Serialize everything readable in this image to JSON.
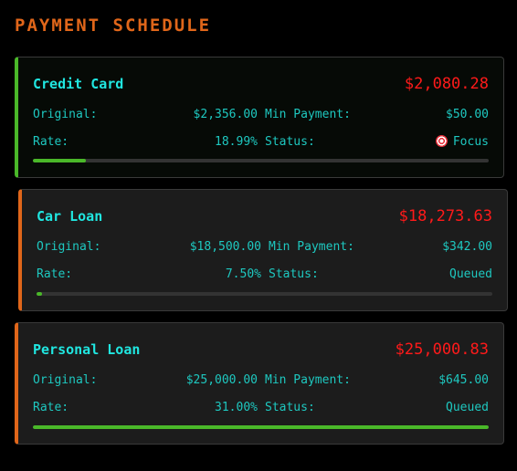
{
  "title": "PAYMENT SCHEDULE",
  "labels": {
    "original": "Original:",
    "min_payment": "Min Payment:",
    "rate": "Rate:",
    "status": "Status:"
  },
  "colors": {
    "accent": "#e0661a",
    "progress": "#4ab829",
    "balance": "#ff1a1a",
    "text": "#1ec8c0",
    "name": "#20e6e0",
    "active_border": "#4ab829",
    "queued_border": "#e0661a"
  },
  "debts": [
    {
      "name": "Credit Card",
      "balance": "$2,080.28",
      "original": "$2,356.00",
      "min_payment": "$50.00",
      "rate": "18.99%",
      "status": "Focus",
      "status_icon": "target-icon",
      "progress": 0.117
    },
    {
      "name": "Car Loan",
      "balance": "$18,273.63",
      "original": "$18,500.00",
      "min_payment": "$342.00",
      "rate": "7.50%",
      "status": "Queued",
      "progress": 0.012
    },
    {
      "name": "Personal Loan",
      "balance": "$25,000.83",
      "original": "$25,000.00",
      "min_payment": "$645.00",
      "rate": "31.00%",
      "status": "Queued",
      "progress": 1.0
    }
  ]
}
